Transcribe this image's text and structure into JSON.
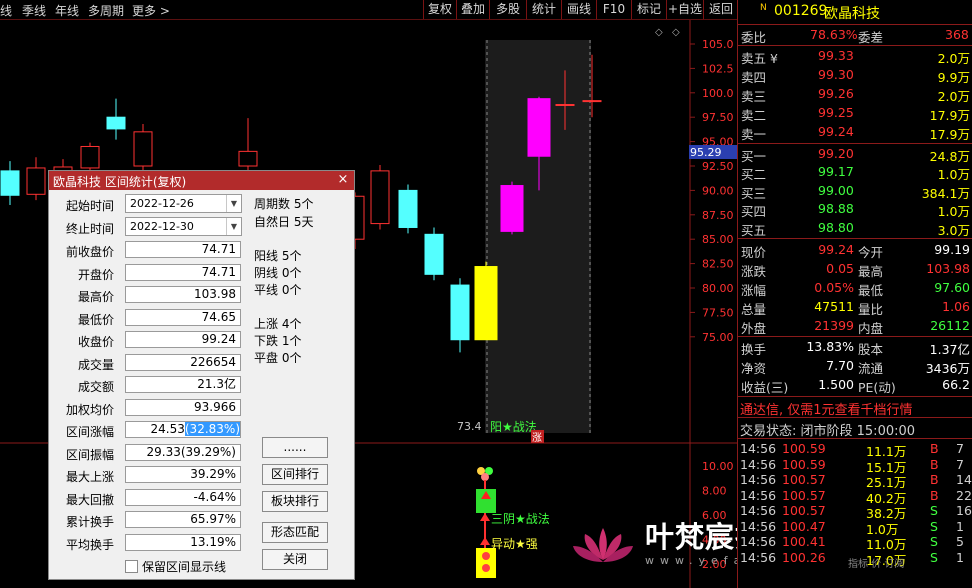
{
  "toolbar": {
    "left": [
      "线",
      "季线",
      "年线",
      "多周期",
      "更多 >"
    ],
    "right": [
      "复权",
      "叠加",
      "多股",
      "统计",
      "画线",
      "F10",
      "标记",
      "+自选",
      "返回"
    ]
  },
  "price_axis": {
    "ticks": [
      "105.0",
      "102.5",
      "100.0",
      "97.50",
      "95.00",
      "92.50",
      "90.00",
      "87.50",
      "85.00",
      "82.50",
      "80.00",
      "77.50",
      "75.00"
    ],
    "current_price_tag": "95.29",
    "volume_ticks": [
      "10.00",
      "8.00",
      "6.00",
      "4.00",
      "2.00"
    ]
  },
  "chart_annotations": {
    "low_label": "73.4",
    "strategy1": "阳★战法",
    "zhang_badge": "涨",
    "strategy2": "三阴★战法",
    "strategy3": "异动★强"
  },
  "colors": {
    "up": "#ff3232",
    "down": "#54ffff",
    "magenta": "#ff00ff",
    "yellow": "#ffff00",
    "accent_red": "#b22b2b"
  },
  "quote_panel": {
    "header_symbol": "N",
    "code": "001269",
    "name": "欧晶科技",
    "weibi_label": "委比",
    "weibi_value": "78.63%",
    "weicha_label": "委差",
    "weicha_value": "368",
    "sell": [
      {
        "label": "卖五 ¥",
        "price": "99.33",
        "vol": "2.0万"
      },
      {
        "label": "卖四",
        "price": "99.30",
        "vol": "9.9万"
      },
      {
        "label": "卖三",
        "price": "99.26",
        "vol": "2.0万"
      },
      {
        "label": "卖二",
        "price": "99.25",
        "vol": "17.9万"
      },
      {
        "label": "卖一",
        "price": "99.24",
        "vol": "17.9万"
      }
    ],
    "buy": [
      {
        "label": "买一",
        "price": "99.20",
        "vol": "24.8万"
      },
      {
        "label": "买二",
        "price": "99.17",
        "vol": "1.0万"
      },
      {
        "label": "买三",
        "price": "99.00",
        "vol": "384.1万"
      },
      {
        "label": "买四",
        "price": "98.88",
        "vol": "1.0万"
      },
      {
        "label": "买五",
        "price": "98.80",
        "vol": "3.0万"
      }
    ],
    "stats": [
      {
        "l1": "现价",
        "v1": "99.24",
        "l2": "今开",
        "v2": "99.19"
      },
      {
        "l1": "涨跌",
        "v1": "0.05",
        "l2": "最高",
        "v2": "103.98"
      },
      {
        "l1": "涨幅",
        "v1": "0.05%",
        "l2": "最低",
        "v2": "97.60"
      },
      {
        "l1": "总量",
        "v1": "47511",
        "l2": "量比",
        "v2": "1.06"
      },
      {
        "l1": "外盘",
        "v1": "21399",
        "l2": "内盘",
        "v2": "26112"
      }
    ],
    "stats2": [
      {
        "l1": "换手",
        "v1": "13.83%",
        "l2": "股本",
        "v2": "1.37亿"
      },
      {
        "l1": "净资",
        "v1": "7.70",
        "l2": "流通",
        "v2": "3436万"
      },
      {
        "l1": "收益(三)",
        "v1": "1.500",
        "l2": "PE(动)",
        "v2": "66.2"
      }
    ],
    "ad_text": "通达信, 仅需1元查看千档行情",
    "trade_status": "交易状态: 闭市阶段 15:00:00",
    "ticks": [
      {
        "time": "14:56",
        "price": "100.59",
        "vol": "11.1万",
        "bs": "B",
        "n": "7"
      },
      {
        "time": "14:56",
        "price": "100.59",
        "vol": "15.1万",
        "bs": "B",
        "n": "7"
      },
      {
        "time": "14:56",
        "price": "100.57",
        "vol": "25.1万",
        "bs": "B",
        "n": "14"
      },
      {
        "time": "14:56",
        "price": "100.57",
        "vol": "40.2万",
        "bs": "B",
        "n": "22"
      },
      {
        "time": "14:56",
        "price": "100.57",
        "vol": "38.2万",
        "bs": "S",
        "n": "16"
      },
      {
        "time": "14:56",
        "price": "100.47",
        "vol": "1.0万",
        "bs": "S",
        "n": "1"
      },
      {
        "time": "14:56",
        "price": "100.41",
        "vol": "11.0万",
        "bs": "S",
        "n": "5"
      },
      {
        "time": "14:56",
        "price": "100.26",
        "vol": "17.0万",
        "bs": "S",
        "n": "1"
      }
    ],
    "tabs_partial": "指标  价     订阅"
  },
  "dialog": {
    "title": "欧晶科技 区间统计(复权)",
    "close": "×",
    "start_label": "起始时间",
    "start_value": "2022-12-26",
    "end_label": "终止时间",
    "end_value": "2022-12-30",
    "fields": [
      {
        "label": "前收盘价",
        "value": "74.71"
      },
      {
        "label": "开盘价",
        "value": "74.71"
      },
      {
        "label": "最高价",
        "value": "103.98"
      },
      {
        "label": "最低价",
        "value": "74.65"
      },
      {
        "label": "收盘价",
        "value": "99.24"
      },
      {
        "label": "成交量",
        "value": "226654"
      },
      {
        "label": "成交额",
        "value": "21.3亿"
      },
      {
        "label": "加权均价",
        "value": "93.966"
      },
      {
        "label": "区间涨幅",
        "value": "24.53",
        "highlight": "(32.83%)"
      },
      {
        "label": "区间振幅",
        "value": "29.33(39.29%)"
      },
      {
        "label": "最大上涨",
        "value": "39.29%"
      },
      {
        "label": "最大回撤",
        "value": "-4.64%"
      },
      {
        "label": "累计换手",
        "value": "65.97%"
      },
      {
        "label": "平均换手",
        "value": "13.19%"
      }
    ],
    "stats_top": [
      "周期数 5个",
      "自然日 5天"
    ],
    "stats_mid": [
      "阳线 5个",
      "阴线 0个",
      "平线 0个"
    ],
    "stats_low": [
      "上涨 4个",
      "下跌 1个",
      "平盘 0个"
    ],
    "buttons": [
      "......",
      "区间排行",
      "板块排行",
      "形态匹配",
      "关闭"
    ],
    "checkbox_label": "保留区间显示线"
  },
  "watermark": {
    "text": "叶梵宸指标公式网",
    "url": "www.yefanchen.com"
  }
}
